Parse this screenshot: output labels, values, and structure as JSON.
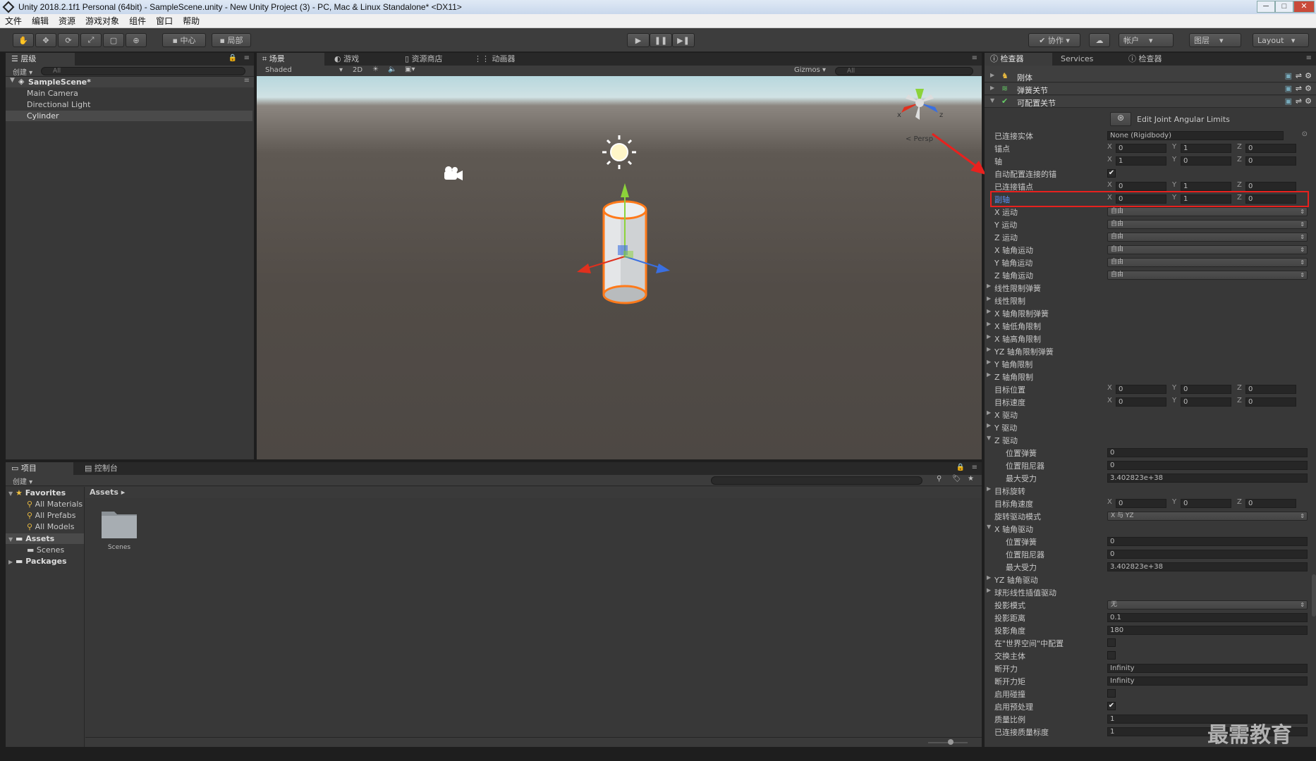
{
  "window": {
    "title": "Unity 2018.2.1f1 Personal (64bit) - SampleScene.unity - New Unity Project (3) - PC, Mac & Linux Standalone* <DX11>",
    "min": "─",
    "max": "□",
    "close": "✕"
  },
  "menu": [
    "文件",
    "编辑",
    "资源",
    "游戏对象",
    "组件",
    "窗口",
    "帮助"
  ],
  "toolbar": {
    "pivot": "中心",
    "local": "局部",
    "collab": "协作",
    "account": "帐户",
    "layers": "图层",
    "layout": "Layout"
  },
  "hierarchy": {
    "tab": "层级",
    "create": "创建",
    "search": "All",
    "scene": "SampleScene*",
    "items": [
      "Main Camera",
      "Directional Light",
      "Cylinder"
    ]
  },
  "center_tabs": [
    "场景",
    "游戏",
    "资源商店",
    "动画器"
  ],
  "scene": {
    "shading": "Shaded",
    "mode2d": "2D",
    "gizmos": "Gizmos",
    "search": "All",
    "persp": "< Persp",
    "axis_x": "x",
    "axis_z": "z"
  },
  "inspector": {
    "tabs": [
      "检查器",
      "Services",
      "检查器"
    ],
    "components": [
      "刚体",
      "弹簧关节",
      "可配置关节"
    ],
    "edit_limits": "Edit Joint Angular Limits",
    "connected_body": {
      "label": "已连接实体",
      "value": "None (Rigidbody)"
    },
    "anchor": {
      "label": "锚点",
      "x": "0",
      "y": "1",
      "z": "0"
    },
    "axis": {
      "label": "轴",
      "x": "1",
      "y": "0",
      "z": "0"
    },
    "auto_config": {
      "label": "自动配置连接的锚"
    },
    "conn_anchor": {
      "label": "已连接锚点",
      "x": "0",
      "y": "1",
      "z": "0"
    },
    "secondary_axis": {
      "label": "副轴",
      "x": "0",
      "y": "1",
      "z": "0"
    },
    "motions": [
      {
        "label": "X 运动",
        "value": "自由"
      },
      {
        "label": "Y 运动",
        "value": "自由"
      },
      {
        "label": "Z 运动",
        "value": "自由"
      },
      {
        "label": "X 轴角运动",
        "value": "自由"
      },
      {
        "label": "Y 轴角运动",
        "value": "自由"
      },
      {
        "label": "Z 轴角运动",
        "value": "自由"
      }
    ],
    "foldouts1": [
      "线性限制弹簧",
      "线性限制",
      "X 轴角限制弹簧",
      "X 轴低角限制",
      "X 轴高角限制",
      "YZ 轴角限制弹簧",
      "Y 轴角限制",
      "Z 轴角限制"
    ],
    "target_position": {
      "label": "目标位置",
      "x": "0",
      "y": "0",
      "z": "0"
    },
    "target_velocity": {
      "label": "目标速度",
      "x": "0",
      "y": "0",
      "z": "0"
    },
    "drives": [
      "X 驱动",
      "Y 驱动",
      "Z 驱动"
    ],
    "z_drive": [
      {
        "label": "位置弹簧",
        "value": "0"
      },
      {
        "label": "位置阻尼器",
        "value": "0"
      },
      {
        "label": "最大受力",
        "value": "3.402823e+38"
      }
    ],
    "target_rotation": "目标旋转",
    "target_ang_vel": {
      "label": "目标角速度",
      "x": "0",
      "y": "0",
      "z": "0"
    },
    "rotation_drive_mode": {
      "label": "旋转驱动模式",
      "value": "X 与 YZ"
    },
    "x_ang_drive": {
      "label": "X 轴角驱动",
      "items": [
        {
          "label": "位置弹簧",
          "value": "0"
        },
        {
          "label": "位置阻尼器",
          "value": "0"
        },
        {
          "label": "最大受力",
          "value": "3.402823e+38"
        }
      ]
    },
    "yz_ang_drive": "YZ 轴角驱动",
    "slerp_drive": "球形线性插值驱动",
    "proj_mode": {
      "label": "投影模式",
      "value": "无"
    },
    "proj_distance": {
      "label": "投影距离",
      "value": "0.1"
    },
    "proj_angle": {
      "label": "投影角度",
      "value": "180"
    },
    "world_space": {
      "label": "在\"世界空间\"中配置"
    },
    "swap_bodies": {
      "label": "交换主体"
    },
    "break_force": {
      "label": "断开力",
      "value": "Infinity"
    },
    "break_torque": {
      "label": "断开力矩",
      "value": "Infinity"
    },
    "enable_collision": {
      "label": "启用碰撞"
    },
    "enable_preprocessing": {
      "label": "启用预处理"
    },
    "mass_scale": {
      "label": "质量比例",
      "value": "1"
    },
    "conn_mass_scale": {
      "label": "已连接质量标度",
      "value": "1"
    }
  },
  "project": {
    "tabs": [
      "项目",
      "控制台"
    ],
    "create": "创建",
    "favorites": "Favorites",
    "fav_items": [
      "All Materials",
      "All Prefabs",
      "All Models"
    ],
    "assets": "Assets",
    "scenes": "Scenes",
    "packages": "Packages",
    "breadcrumb": "Assets",
    "folder": "Scenes"
  },
  "watermark": "最需教育"
}
